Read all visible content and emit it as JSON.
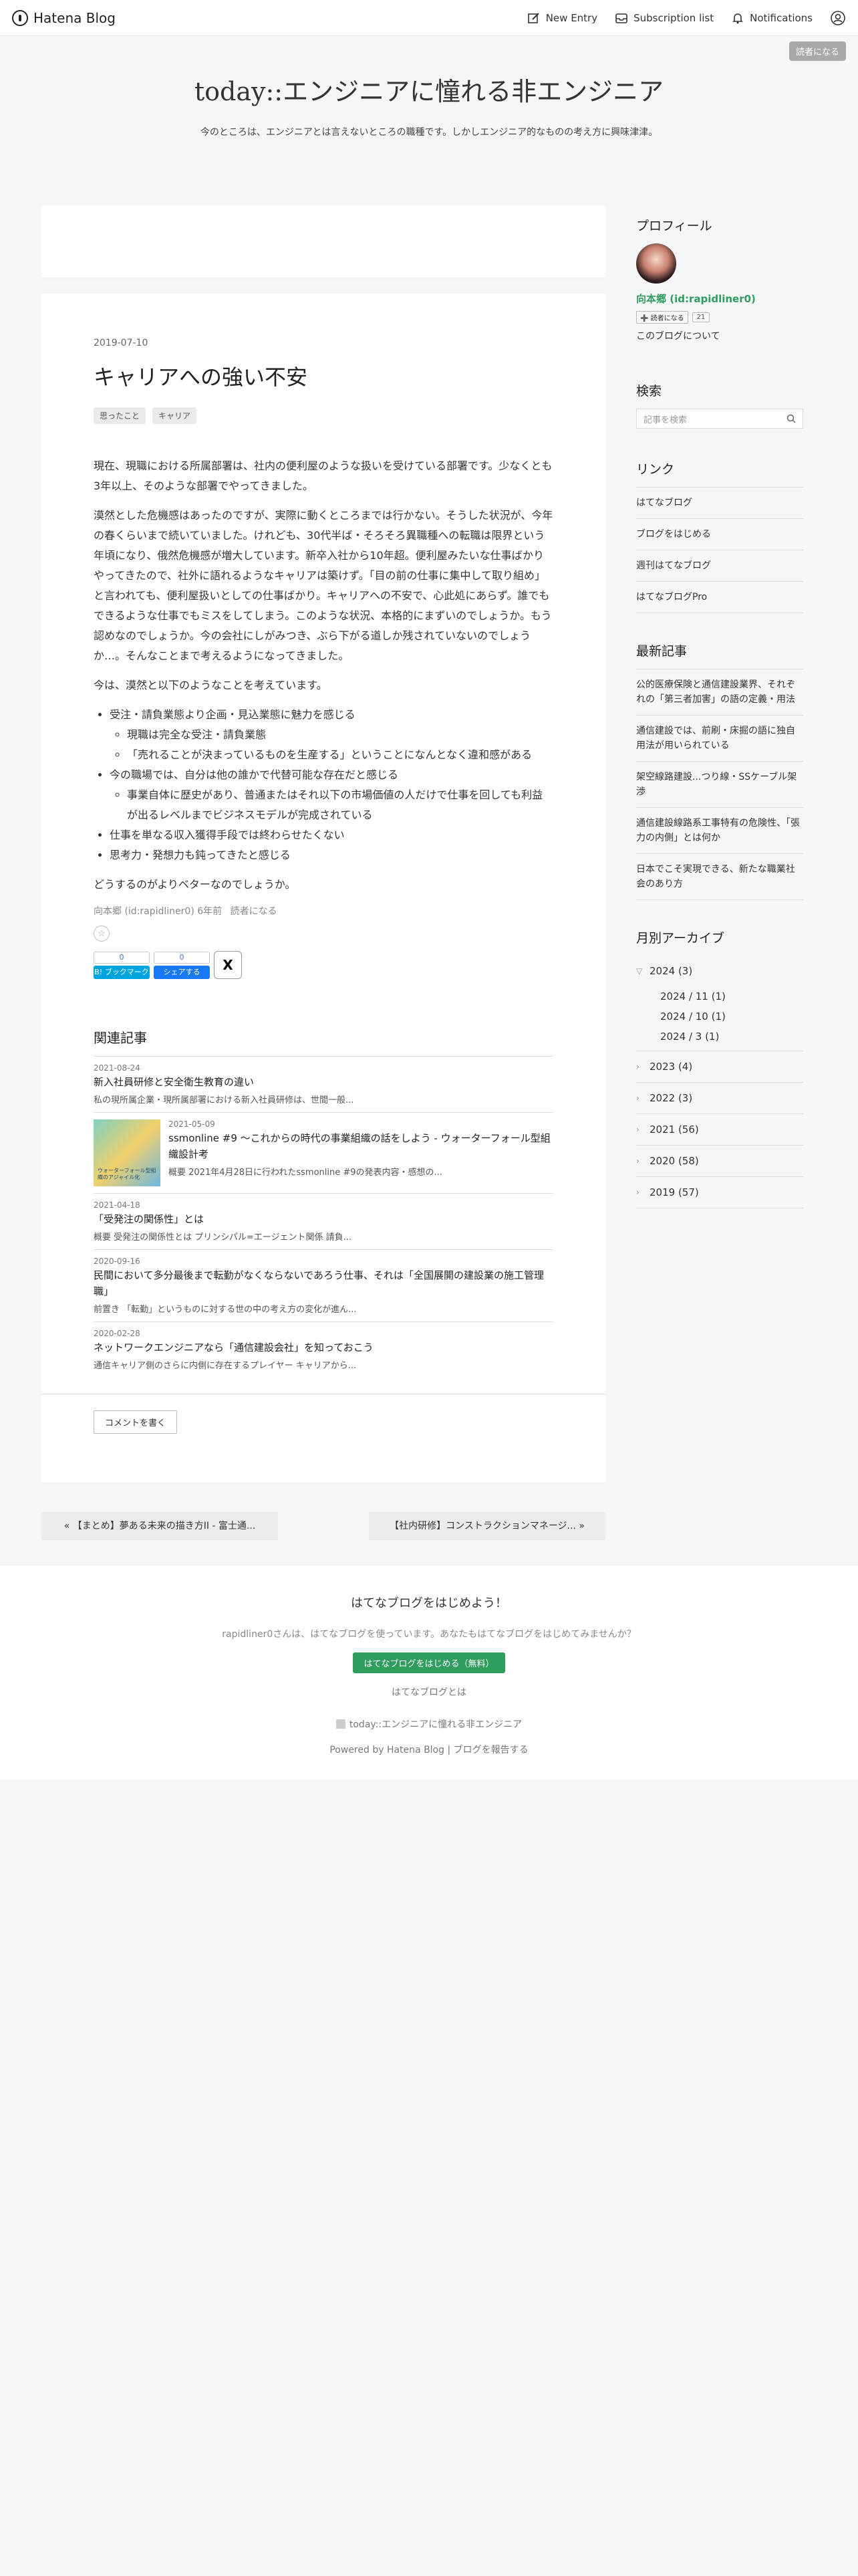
{
  "header": {
    "brand": "Hatena Blog",
    "nav": {
      "new_entry": "New Entry",
      "subscription": "Subscription list",
      "notifications": "Notifications"
    },
    "reader_button": "読者になる"
  },
  "blog": {
    "title": "today::エンジニアに憧れる非エンジニア",
    "description": "今のところは、エンジニアとは言えないところの職種です。しかしエンジニア的なものの考え方に興味津津。"
  },
  "entry": {
    "date": "2019-07-10",
    "title": "キャリアへの強い不安",
    "categories": [
      "思ったこと",
      "キャリア"
    ],
    "paragraphs": [
      "現在、現職における所属部署は、社内の便利屋のような扱いを受けている部署です。少なくとも3年以上、そのような部署でやってきました。",
      "漠然とした危機感はあったのですが、実際に動くところまでは行かない。そうした状況が、今年の春くらいまで続いていました。けれども、30代半ば・そろそろ異職種への転職は限界という年頃になり、俄然危機感が増大しています。新卒入社から10年超。便利屋みたいな仕事ばかりやってきたので、社外に語れるようなキャリアは築けず。「目の前の仕事に集中して取り組め」と言われても、便利屋扱いとしての仕事ばかり。キャリアへの不安で、心此処にあらず。誰でもできるような仕事でもミスをしてしまう。このような状況、本格的にまずいのでしょうか。もう認めなのでしょうか。今の会社にしがみつき、ぶら下がる道しか残されていないのでしょうか…。そんなことまで考えるようになってきました。",
      "今は、漠然と以下のようなことを考えています。"
    ],
    "list": [
      {
        "text": "受注・請負業態より企画・見込業態に魅力を感じる",
        "sub": [
          "現職は完全な受注・請負業態",
          "「売れることが決まっているものを生産する」ということになんとなく違和感がある"
        ]
      },
      {
        "text": "今の職場では、自分は他の誰かで代替可能な存在だと感じる",
        "sub": [
          "事業自体に歴史があり、普通またはそれ以下の市場価値の人だけで仕事を回しても利益が出るレベルまでビジネスモデルが完成されている"
        ]
      },
      {
        "text": "仕事を単なる収入獲得手段では終わらせたくない",
        "sub": []
      },
      {
        "text": "思考力・発想力も鈍ってきたと感じる",
        "sub": []
      }
    ],
    "closing": "どうするのがよりベターなのでしょうか。",
    "meta": "向本郷 (id:rapidliner0) 6年前",
    "meta_reader": "読者になる",
    "star_icon": "☆",
    "share": {
      "hatena_count": "0",
      "hatena_label": "B! ブックマーク",
      "facebook_count": "0",
      "facebook_label": "シェアする",
      "x_label": "X"
    },
    "colors": {
      "hatena": "#00a4de",
      "facebook": "#1877f2"
    }
  },
  "related": {
    "heading": "関連記事",
    "items": [
      {
        "date": "2021-08-24",
        "title": "新入社員研修と安全衛生教育の違い",
        "summary": "私の現所属企業・現所属部署における新入社員研修は、世間一般..."
      },
      {
        "date": "2021-05-09",
        "title": "ssmonline #9 〜これからの時代の事業組織の話をしよう - ウォーターフォール型組織設計考",
        "summary": "概要 2021年4月28日に行われたssmonline #9の発表内容・感想の...",
        "thumb_text": "ウォーターフォール型組織のアジャイル化"
      },
      {
        "date": "2021-04-18",
        "title": "「受発注の関係性」とは",
        "summary": "概要 受発注の関係性とは プリンシパル=エージェント関係 請負..."
      },
      {
        "date": "2020-09-16",
        "title": "民間において多分最後まで転勤がなくならないであろう仕事、それは「全国展開の建設業の施工管理職」",
        "summary": "前置き 「転勤」というものに対する世の中の考え方の変化が進ん..."
      },
      {
        "date": "2020-02-28",
        "title": "ネットワークエンジニアなら「通信建設会社」を知っておこう",
        "summary": "通信キャリア側のさらに内側に存在するプレイヤー キャリアから..."
      }
    ]
  },
  "comment_button": "コメントを書く",
  "pager": {
    "prev": "« 【まとめ】夢ある未来の描き方II - 富士通...",
    "next": "【社内研修】コンストラクションマネージ... »"
  },
  "sidebar": {
    "profile": {
      "heading": "プロフィール",
      "id": "向本郷 (id:rapidliner0)",
      "follow": "➕ 読者になる",
      "count": "21",
      "about": "このブログについて"
    },
    "search": {
      "heading": "検索",
      "placeholder": "記事を検索"
    },
    "links": {
      "heading": "リンク",
      "items": [
        "はてなブログ",
        "ブログをはじめる",
        "週刊はてなブログ",
        "はてなブログPro"
      ]
    },
    "recent": {
      "heading": "最新記事",
      "items": [
        "公的医療保険と通信建設業界、それぞれの「第三者加害」の語の定義・用法",
        "通信建設では、前刷・床掘の語に独自用法が用いられている",
        "架空線路建設...つり線・SSケーブル架渉",
        "通信建設線路系工事特有の危険性、「張力の内側」とは何か",
        "日本でこそ実現できる、新たな職業社会のあり方"
      ]
    },
    "archive": {
      "heading": "月別アーカイブ",
      "expanded": {
        "label": "2024 (3)",
        "months": [
          "2024 / 11 (1)",
          "2024 / 10 (1)",
          "2024 / 3 (1)"
        ]
      },
      "years": [
        "2023 (4)",
        "2022 (3)",
        "2021 (56)",
        "2020 (58)",
        "2019 (57)"
      ]
    }
  },
  "footer": {
    "title": "はてなブログをはじめよう！",
    "message": "rapidliner0さんは、はてなブログを使っています。あなたもはてなブログをはじめてみませんか？",
    "start_button": "はてなブログをはじめる（無料）",
    "about": "はてなブログとは",
    "blog_link": "today::エンジニアに憧れる非エンジニア",
    "powered": "Powered by Hatena Blog | ブログを報告する"
  }
}
